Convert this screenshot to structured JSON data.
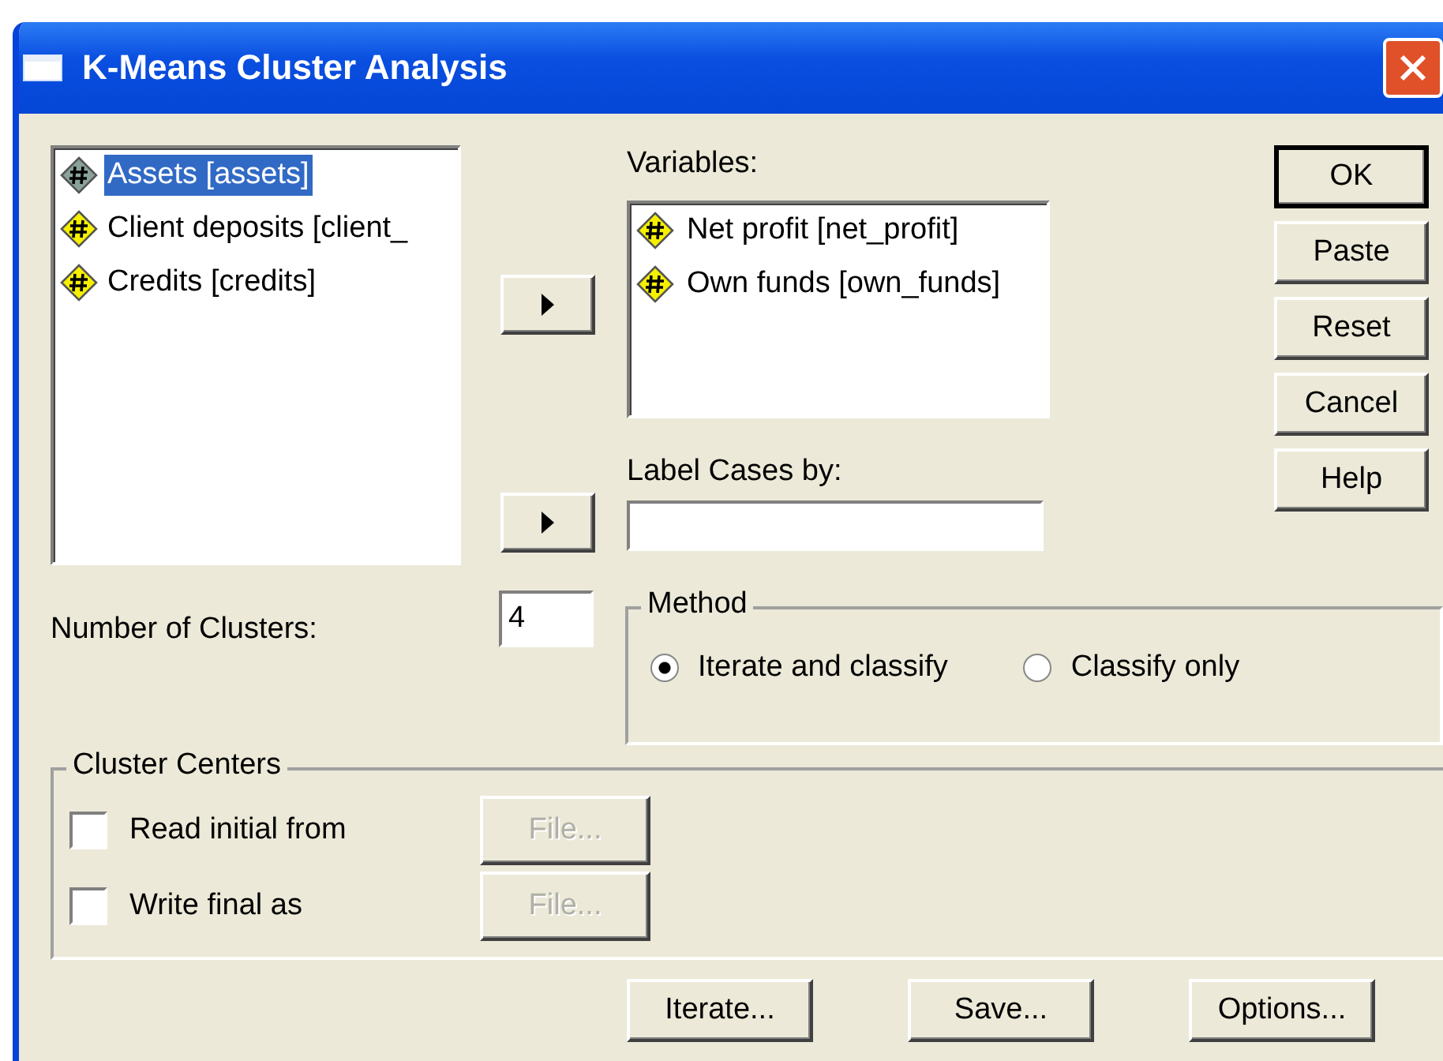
{
  "window": {
    "title": "K-Means Cluster Analysis"
  },
  "source_list": {
    "items": [
      {
        "label": "Assets [assets]",
        "selected": true
      },
      {
        "label": "Client deposits [client_",
        "selected": false
      },
      {
        "label": "Credits  [credits]",
        "selected": false
      }
    ]
  },
  "variables": {
    "label": "Variables:",
    "items": [
      {
        "label": "Net profit [net_profit]"
      },
      {
        "label": "Own funds [own_funds]"
      }
    ]
  },
  "label_cases": {
    "label": "Label Cases by:"
  },
  "buttons": [
    {
      "label": "OK",
      "default": true
    },
    {
      "label": "Paste",
      "default": false
    },
    {
      "label": "Reset",
      "default": false
    },
    {
      "label": "Cancel",
      "default": false
    },
    {
      "label": "Help",
      "default": false
    }
  ],
  "clusters": {
    "label": "Number of Clusters:",
    "value": "4"
  },
  "method": {
    "title": "Method",
    "options": [
      {
        "label": "Iterate and classify",
        "selected": true
      },
      {
        "label": "Classify only",
        "selected": false
      }
    ]
  },
  "cluster_centers": {
    "title": "Cluster Centers",
    "rows": [
      {
        "label": "Read initial from",
        "checked": false,
        "button": "File...",
        "disabled": true
      },
      {
        "label": "Write final as",
        "checked": false,
        "button": "File...",
        "disabled": true
      }
    ]
  },
  "bottom_buttons": [
    "Iterate...",
    "Save...",
    "Options..."
  ]
}
